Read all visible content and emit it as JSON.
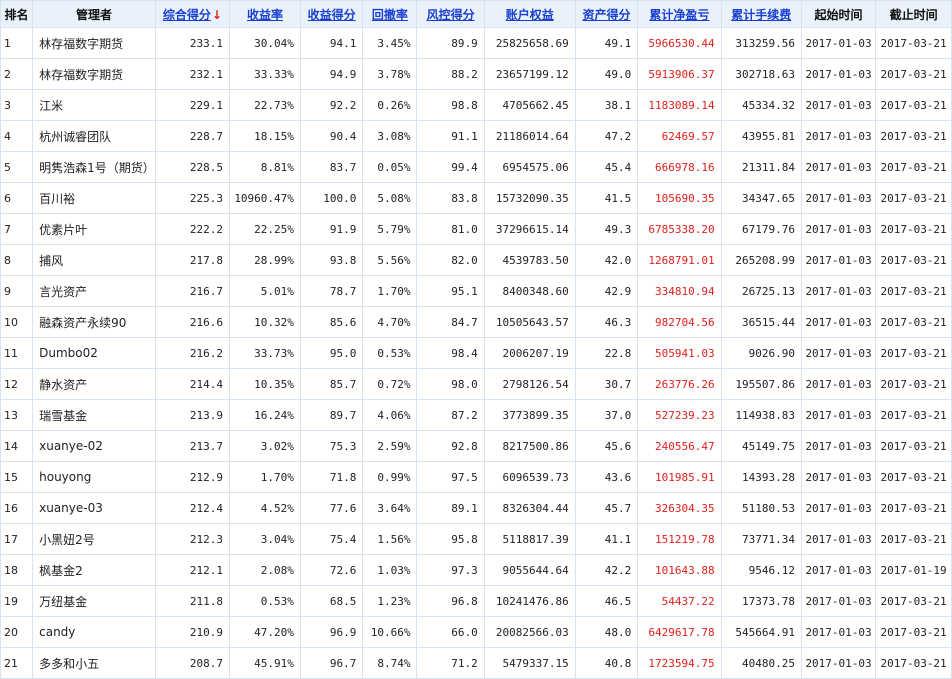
{
  "headers": {
    "rank": "排名",
    "manager": "管理者",
    "composite_score": "综合得分",
    "return_rate": "收益率",
    "return_score": "收益得分",
    "drawdown": "回撤率",
    "risk_score": "风控得分",
    "account_equity": "账户权益",
    "asset_score": "资产得分",
    "cum_pnl": "累计净盈亏",
    "cum_fee": "累计手续费",
    "start_time": "起始时间",
    "end_time": "截止时间"
  },
  "sort_arrow": "↓",
  "colors": {
    "header_bg": "#e9f2fb",
    "link": "#1b3fd1",
    "negative_red": "#e0201c",
    "border": "#d7e4ef"
  },
  "rows": [
    [
      "1",
      "林存福数字期货",
      "233.1",
      "30.04%",
      "94.1",
      "3.45%",
      "89.9",
      "25825658.69",
      "49.1",
      "5966530.44",
      "313259.56",
      "2017-01-03",
      "2017-03-21"
    ],
    [
      "2",
      "林存福数字期货",
      "232.1",
      "33.33%",
      "94.9",
      "3.78%",
      "88.2",
      "23657199.12",
      "49.0",
      "5913906.37",
      "302718.63",
      "2017-01-03",
      "2017-03-21"
    ],
    [
      "3",
      "江米",
      "229.1",
      "22.73%",
      "92.2",
      "0.26%",
      "98.8",
      "4705662.45",
      "38.1",
      "1183089.14",
      "45334.32",
      "2017-01-03",
      "2017-03-21"
    ],
    [
      "4",
      "杭州诚睿团队",
      "228.7",
      "18.15%",
      "90.4",
      "3.08%",
      "91.1",
      "21186014.64",
      "47.2",
      "62469.57",
      "43955.81",
      "2017-01-03",
      "2017-03-21"
    ],
    [
      "5",
      "明隽浩森1号（期货）",
      "228.5",
      "8.81%",
      "83.7",
      "0.05%",
      "99.4",
      "6954575.06",
      "45.4",
      "666978.16",
      "21311.84",
      "2017-01-03",
      "2017-03-21"
    ],
    [
      "6",
      "百川裕",
      "225.3",
      "10960.47%",
      "100.0",
      "5.08%",
      "83.8",
      "15732090.35",
      "41.5",
      "105690.35",
      "34347.65",
      "2017-01-03",
      "2017-03-21"
    ],
    [
      "7",
      "优素片叶",
      "222.2",
      "22.25%",
      "91.9",
      "5.79%",
      "81.0",
      "37296615.14",
      "49.3",
      "6785338.20",
      "67179.76",
      "2017-01-03",
      "2017-03-21"
    ],
    [
      "8",
      "捕风",
      "217.8",
      "28.99%",
      "93.8",
      "5.56%",
      "82.0",
      "4539783.50",
      "42.0",
      "1268791.01",
      "265208.99",
      "2017-01-03",
      "2017-03-21"
    ],
    [
      "9",
      "言光资产",
      "216.7",
      "5.01%",
      "78.7",
      "1.70%",
      "95.1",
      "8400348.60",
      "42.9",
      "334810.94",
      "26725.13",
      "2017-01-03",
      "2017-03-21"
    ],
    [
      "10",
      "融森资产永续90",
      "216.6",
      "10.32%",
      "85.6",
      "4.70%",
      "84.7",
      "10505643.57",
      "46.3",
      "982704.56",
      "36515.44",
      "2017-01-03",
      "2017-03-21"
    ],
    [
      "11",
      "Dumbo02",
      "216.2",
      "33.73%",
      "95.0",
      "0.53%",
      "98.4",
      "2006207.19",
      "22.8",
      "505941.03",
      "9026.90",
      "2017-01-03",
      "2017-03-21"
    ],
    [
      "12",
      "静水资产",
      "214.4",
      "10.35%",
      "85.7",
      "0.72%",
      "98.0",
      "2798126.54",
      "30.7",
      "263776.26",
      "195507.86",
      "2017-01-03",
      "2017-03-21"
    ],
    [
      "13",
      "瑞雪基金",
      "213.9",
      "16.24%",
      "89.7",
      "4.06%",
      "87.2",
      "3773899.35",
      "37.0",
      "527239.23",
      "114938.83",
      "2017-01-03",
      "2017-03-21"
    ],
    [
      "14",
      "xuanye-02",
      "213.7",
      "3.02%",
      "75.3",
      "2.59%",
      "92.8",
      "8217500.86",
      "45.6",
      "240556.47",
      "45149.75",
      "2017-01-03",
      "2017-03-21"
    ],
    [
      "15",
      "houyong",
      "212.9",
      "1.70%",
      "71.8",
      "0.99%",
      "97.5",
      "6096539.73",
      "43.6",
      "101985.91",
      "14393.28",
      "2017-01-03",
      "2017-03-21"
    ],
    [
      "16",
      "xuanye-03",
      "212.4",
      "4.52%",
      "77.6",
      "3.64%",
      "89.1",
      "8326304.44",
      "45.7",
      "326304.35",
      "51180.53",
      "2017-01-03",
      "2017-03-21"
    ],
    [
      "17",
      "小黑妞2号",
      "212.3",
      "3.04%",
      "75.4",
      "1.56%",
      "95.8",
      "5118817.39",
      "41.1",
      "151219.78",
      "73771.34",
      "2017-01-03",
      "2017-03-21"
    ],
    [
      "18",
      "枫基金2",
      "212.1",
      "2.08%",
      "72.6",
      "1.03%",
      "97.3",
      "9055644.64",
      "42.2",
      "101643.88",
      "9546.12",
      "2017-01-03",
      "2017-01-19"
    ],
    [
      "19",
      "万纽基金",
      "211.8",
      "0.53%",
      "68.5",
      "1.23%",
      "96.8",
      "10241476.86",
      "46.5",
      "54437.22",
      "17373.78",
      "2017-01-03",
      "2017-03-21"
    ],
    [
      "20",
      "candy",
      "210.9",
      "47.20%",
      "96.9",
      "10.66%",
      "66.0",
      "20082566.03",
      "48.0",
      "6429617.78",
      "545664.91",
      "2017-01-03",
      "2017-03-21"
    ],
    [
      "21",
      "多多和小五",
      "208.7",
      "45.91%",
      "96.7",
      "8.74%",
      "71.2",
      "5479337.15",
      "40.8",
      "1723594.75",
      "40480.25",
      "2017-01-03",
      "2017-03-21"
    ]
  ]
}
